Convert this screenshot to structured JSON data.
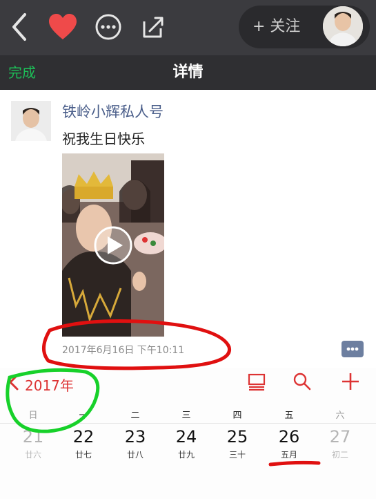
{
  "header": {
    "follow_label": "+ 关注",
    "done_label": "完成",
    "title": "详情"
  },
  "post": {
    "username": "铁岭小辉私人号",
    "text": "祝我生日快乐",
    "time": "2017年6月16日  下午10:11"
  },
  "calendar": {
    "year_label": "2017年",
    "weekdays": [
      "日",
      "一",
      "二",
      "三",
      "四",
      "五",
      "六"
    ],
    "days": [
      {
        "num": "21",
        "lunar": "廿六"
      },
      {
        "num": "22",
        "lunar": "廿七"
      },
      {
        "num": "23",
        "lunar": "廿八"
      },
      {
        "num": "24",
        "lunar": "廿九"
      },
      {
        "num": "25",
        "lunar": "三十"
      },
      {
        "num": "26",
        "lunar": "五月"
      },
      {
        "num": "27",
        "lunar": "初二"
      }
    ]
  },
  "colors": {
    "accent_red": "#d33",
    "done_green": "#1dbf58",
    "annotation_red": "#e01010",
    "annotation_green": "#17d12a",
    "heart": "#ef4a4a"
  }
}
